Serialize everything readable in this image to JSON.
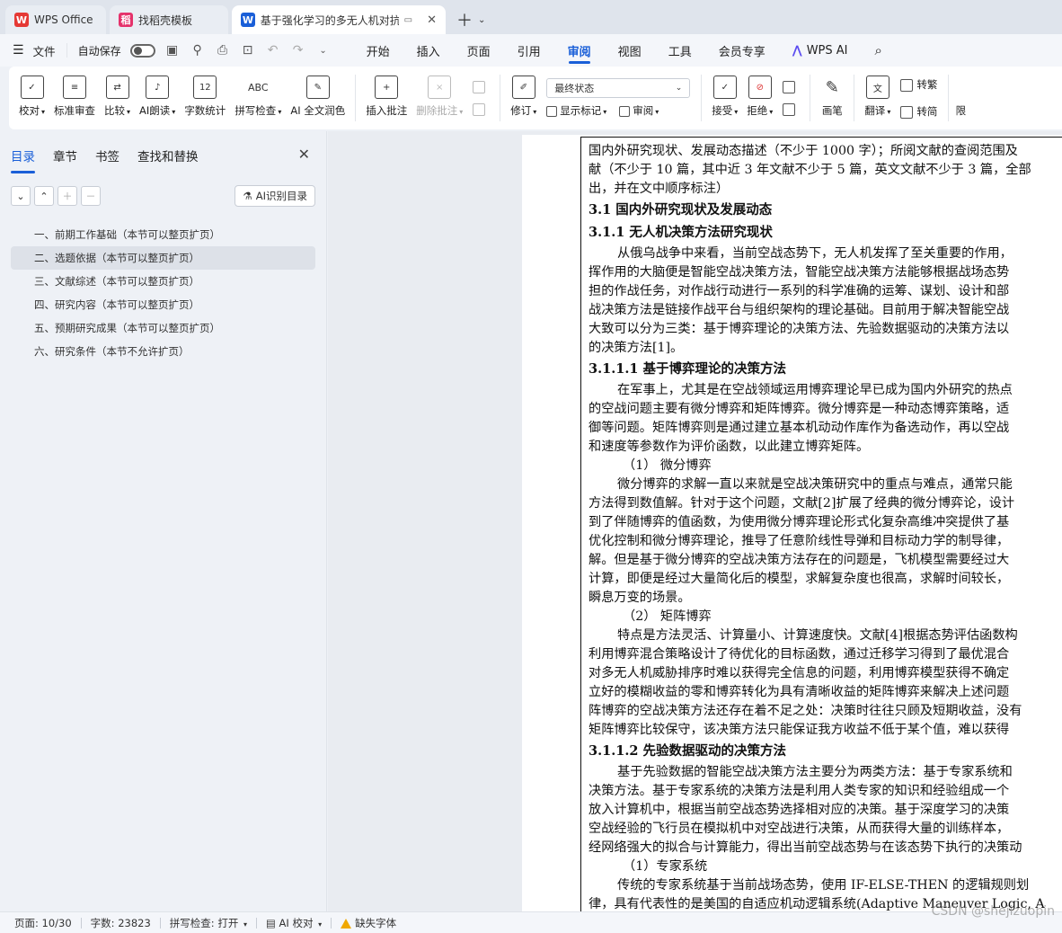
{
  "tabs": [
    {
      "label": "WPS Office",
      "icon": "wps-logo-icon",
      "color": "#e53935"
    },
    {
      "label": "找稻壳模板",
      "icon": "docer-logo-icon",
      "color": "#e5326b"
    },
    {
      "label": "基于强化学习的多无人机对抗",
      "icon": "word-doc-icon",
      "color": "#1a5fd8"
    }
  ],
  "menubar": {
    "file": "文件",
    "autosave": "自动保存",
    "tabs": [
      "开始",
      "插入",
      "页面",
      "引用",
      "审阅",
      "视图",
      "工具",
      "会员专享",
      "WPS AI"
    ],
    "active_tab": "审阅"
  },
  "ribbon": {
    "proof": "校对",
    "standard_review": "标准审查",
    "compare": "比较",
    "ai_read": "AI朗读",
    "word_count": "字数统计",
    "spell_check": "拼写检查",
    "ai_polish": "AI 全文润色",
    "insert_comment": "插入批注",
    "delete_comment": "删除批注",
    "revise": "修订",
    "state_select": "最终状态",
    "show_marks": "显示标记",
    "review_pane": "审阅",
    "accept": "接受",
    "reject": "拒绝",
    "pen": "画笔",
    "translate": "翻译",
    "to_traditional": "转繁",
    "to_simplified": "转简",
    "limit": "限"
  },
  "pane": {
    "tabs": [
      "目录",
      "章节",
      "书签",
      "查找和替换"
    ],
    "ai_toc": "AI识别目录",
    "toc": [
      "一、前期工作基础（本节可以整页扩页）",
      "二、选题依据（本节可以整页扩页）",
      "三、文献综述（本节可以整页扩页）",
      "四、研究内容（本节可以整页扩页）",
      "五、预期研究成果（本节可以整页扩页）",
      "六、研究条件（本节不允许扩页）"
    ]
  },
  "doc": {
    "l1": "国内外研究现状、发展动态描述（不少于 1000 字）；所阅文献的查阅范围及",
    "l2": "献（不少于 10 篇，其中近 3 年文献不少于 5 篇，英文文献不少于 3 篇，全部",
    "l3": "出，并在文中顺序标注）",
    "h1": "3.1 国内外研究现状及发展动态",
    "h2": "3.1.1 无人机决策方法研究现状",
    "p1": [
      "从俄乌战争中来看，当前空战态势下，无人机发挥了至关重要的作用，",
      "挥作用的大脑便是智能空战决策方法，智能空战决策方法能够根据战场态势",
      "担的作战任务，对作战行动进行一系列的科学准确的运筹、谋划、设计和部",
      "战决策方法是链接作战平台与组织架构的理论基础。目前用于解决智能空战",
      "大致可以分为三类：基于博弈理论的决策方法、先验数据驱动的决策方法以",
      "的决策方法[1]。"
    ],
    "h3": "3.1.1.1 基于博弈理论的决策方法",
    "p2": [
      "在军事上，尤其是在空战领域运用博弈理论早已成为国内外研究的热点",
      "的空战问题主要有微分博弈和矩阵博弈。微分博弈是一种动态博弈策略，适",
      "御等问题。矩阵博弈则是通过建立基本机动动作库作为备选动作，再以空战",
      "和速度等参数作为评价函数，以此建立博弈矩阵。"
    ],
    "s1": "（1）  微分博弈",
    "p3": [
      "微分博弈的求解一直以来就是空战决策研究中的重点与难点，通常只能",
      "方法得到数值解。针对于这个问题，文献[2]扩展了经典的微分博弈论，设计",
      "到了伴随博弈的值函数，为使用微分博弈理论形式化复杂高维冲突提供了基",
      "优化控制和微分博弈理论，推导了任意阶线性导弹和目标动力学的制导律，",
      "解。但是基于微分博弈的空战决策方法存在的问题是，飞机模型需要经过大",
      "计算，即便是经过大量简化后的模型，求解复杂度也很高，求解时间较长，",
      "瞬息万变的场景。"
    ],
    "s2": "（2）  矩阵博弈",
    "p4": [
      "特点是方法灵活、计算量小、计算速度快。文献[4]根据态势评估函数构",
      "利用博弈混合策略设计了待优化的目标函数，通过迁移学习得到了最优混合",
      "对多无人机威胁排序时难以获得完全信息的问题，利用博弈模型获得不确定",
      "立好的模糊收益的零和博弈转化为具有清晰收益的矩阵博弈来解决上述问题",
      "阵博弈的空战决策方法还存在着不足之处：决策时往往只顾及短期收益，没有",
      "矩阵博弈比较保守，该决策方法只能保证我方收益不低于某个值，难以获得"
    ],
    "h4": "3.1.1.2 先验数据驱动的决策方法",
    "p5": [
      "基于先验数据的智能空战决策方法主要分为两类方法：基于专家系统和",
      "决策方法。基于专家系统的决策方法是利用人类专家的知识和经验组成一个",
      "放入计算机中，根据当前空战态势选择相对应的决策。基于深度学习的决策",
      "空战经验的飞行员在模拟机中对空战进行决策，从而获得大量的训练样本，",
      "经网络强大的拟合与计算能力，得出当前空战态势与在该态势下执行的决策动"
    ],
    "s3": "（1）专家系统",
    "p6": [
      "传统的专家系统基于当前战场态势，使用 IF-ELSE-THEN 的逻辑规则划",
      "律，具有代表性的是美国的自适应机动逻辑系统(Adaptive Maneuver Logic, A"
    ]
  },
  "status": {
    "page": "页面: 10/30",
    "words": "字数: 23823",
    "spell": "拼写检查: 打开",
    "ai_proof": "AI 校对",
    "missing_font": "缺失字体"
  },
  "watermark": "CSDN @shejizuopin",
  "colors": {
    "accent": "#1a5fd8",
    "warning": "#f0a800"
  }
}
